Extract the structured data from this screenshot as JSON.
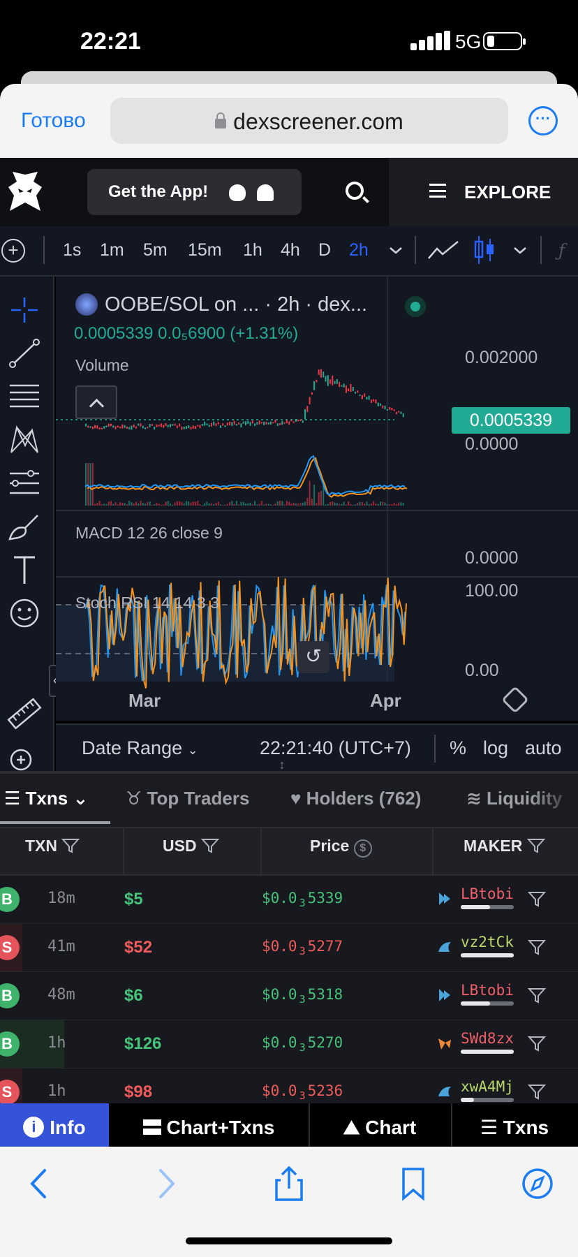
{
  "status_bar": {
    "time": "22:21",
    "network": "5G"
  },
  "safari": {
    "done_label": "Готово",
    "url": "dexscreener.com"
  },
  "site_header": {
    "get_app_label": "Get the App!",
    "explore_label": "EXPLORE"
  },
  "toolbar": {
    "timeframes": [
      "1s",
      "1m",
      "5m",
      "15m",
      "1h",
      "4h",
      "D",
      "2h"
    ],
    "active_timeframe": "2h",
    "active_color": "#2962ff"
  },
  "chart": {
    "title": "OOBE/SOL on ... · 2h · dex...",
    "price_line": "0.0005339 0.0₅6900 (+1.31%)",
    "volume_label": "Volume",
    "macd_label": "MACD 12 26 close 9",
    "stoch_label": "Stoch RSI 14 14 3 3",
    "price_axis_top": "0.002000",
    "current_price": "0.0005339",
    "price_axis_zero": "0.0000",
    "macd_axis": "0.0000",
    "stoch_axis_top": "100.00",
    "stoch_axis_bottom": "0.00",
    "date_labels": [
      "Mar",
      "Apr"
    ],
    "up_color": "#22ab94",
    "down_color": "#f23645",
    "bottom_bar": {
      "date_range": "Date Range",
      "clock": "22:21:40 (UTC+7)",
      "percent": "%",
      "log": "log",
      "auto": "auto"
    }
  },
  "tabs": [
    {
      "label": "Txns"
    },
    {
      "label": "Top Traders"
    },
    {
      "label": "Holders (762)"
    },
    {
      "label": "Liquidity"
    }
  ],
  "table": {
    "headers": [
      "TXN",
      "USD",
      "Price",
      "MAKER"
    ],
    "rows": [
      {
        "type": "B",
        "age": "18m",
        "usd": "$5",
        "price_pre": "$0.0",
        "price_sub": "3",
        "price_post": "5339",
        "maker": "LBtobi",
        "maker_color": "#f0606a",
        "bar": 0.55
      },
      {
        "type": "S",
        "age": "41m",
        "usd": "$52",
        "price_pre": "$0.0",
        "price_sub": "3",
        "price_post": "5277",
        "maker": "vz2tCk",
        "maker_color": "#b8d96a",
        "bar": 1.0
      },
      {
        "type": "B",
        "age": "48m",
        "usd": "$6",
        "price_pre": "$0.0",
        "price_sub": "3",
        "price_post": "5318",
        "maker": "LBtobi",
        "maker_color": "#f0606a",
        "bar": 0.55
      },
      {
        "type": "B",
        "age": "1h",
        "usd": "$126",
        "price_pre": "$0.0",
        "price_sub": "3",
        "price_post": "5270",
        "maker": "SWd8zx",
        "maker_color": "#f0606a",
        "bar": 1.0
      },
      {
        "type": "S",
        "age": "1h",
        "usd": "$98",
        "price_pre": "$0.0",
        "price_sub": "3",
        "price_post": "5236",
        "maker": "xwA4Mj",
        "maker_color": "#b8d96a",
        "bar": 0.25
      }
    ],
    "buy_color": "#46c37b",
    "sell_color": "#ef5b5b"
  },
  "bottom_nav": {
    "info": "Info",
    "chart_txns": "Chart+Txns",
    "chart": "Chart",
    "txns": "Txns"
  }
}
